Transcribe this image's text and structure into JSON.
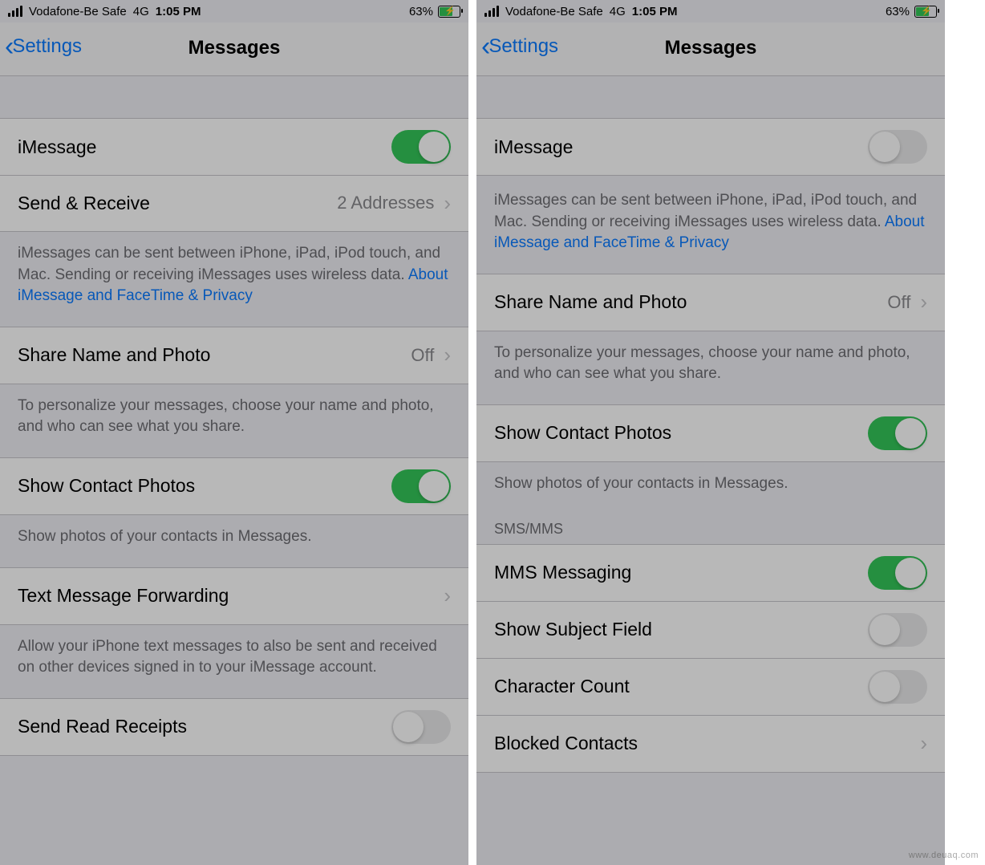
{
  "status": {
    "carrier": "Vodafone-Be Safe",
    "net": "4G",
    "time": "1:05 PM",
    "battery": "63%"
  },
  "nav": {
    "back": "Settings",
    "title": "Messages"
  },
  "common": {
    "imessage": "iMessage",
    "imsg_footer": "iMessages can be sent between iPhone, iPad, iPod touch, and Mac. Sending or receiving iMessages uses wireless data. ",
    "imsg_link": "About iMessage and FaceTime & Privacy",
    "share_name": "Share Name and Photo",
    "share_val": "Off",
    "share_footer": "To personalize your messages, choose your name and photo, and who can see what you share.",
    "contact_photos": "Show Contact Photos",
    "contact_footer": "Show photos of your contacts in Messages."
  },
  "left": {
    "send_recv": "Send & Receive",
    "send_recv_val": "2 Addresses",
    "fwd": "Text Message Forwarding",
    "fwd_footer": "Allow your iPhone text messages to also be sent and received on other devices signed in to your iMessage account.",
    "read": "Send Read Receipts"
  },
  "right": {
    "sms_head": "SMS/MMS",
    "mms": "MMS Messaging",
    "subject": "Show Subject Field",
    "char": "Character Count",
    "blocked": "Blocked Contacts"
  },
  "watermark": "www.deuaq.com"
}
